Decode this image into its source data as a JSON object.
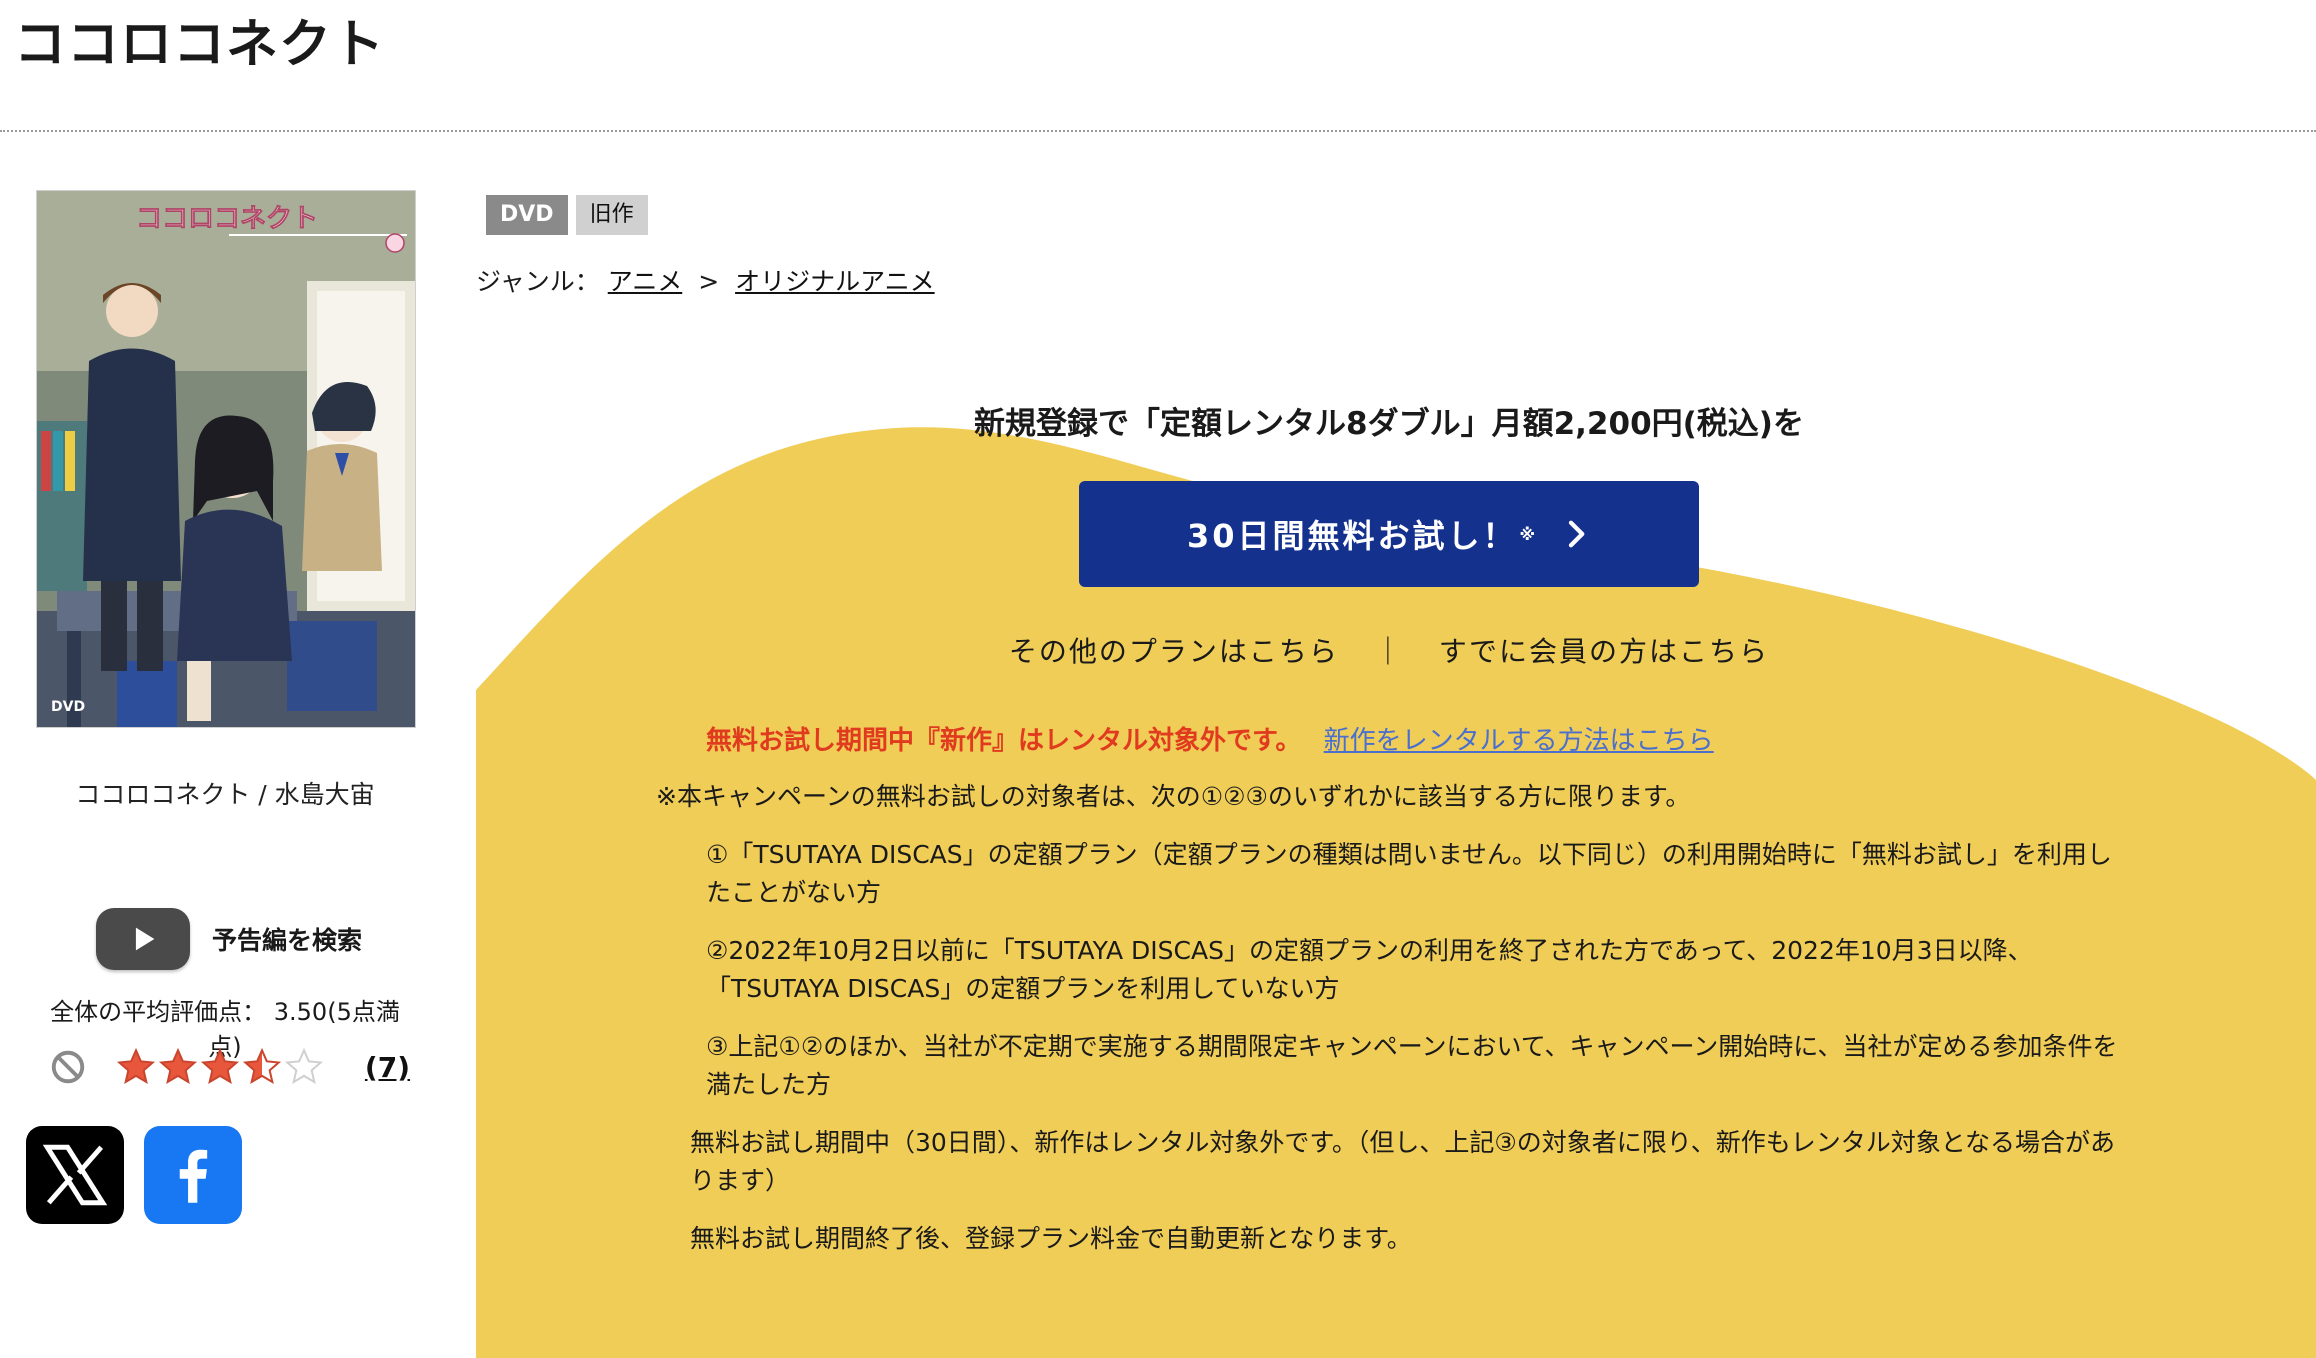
{
  "page": {
    "title": "ココロコネクト"
  },
  "product": {
    "cover_alt": "ココロコネクト",
    "cover_title_art": "ココロコネクト",
    "caption": "ココロコネクト / 水島大宙",
    "trailer_label": "予告編を検索",
    "rating_text": "全体の平均評価点： 3.50(5点満点)",
    "rating_value": 3.5,
    "rating_max": 5,
    "review_count": "(7)",
    "share": {
      "x_icon": "x-logo-icon",
      "facebook_icon": "facebook-icon"
    }
  },
  "badges": {
    "format": "DVD",
    "status": "旧作"
  },
  "genre": {
    "label": "ジャンル：",
    "items": [
      "アニメ",
      "オリジナルアニメ"
    ],
    "separator": ">"
  },
  "promo": {
    "headline": "新規登録で「定額レンタル8ダブル」月額2,200円(税込)を",
    "cta_label": "30日間無料お試し！",
    "cta_note": "※",
    "other_plans": "その他のプランはこちら",
    "divider": "｜",
    "members": "すでに会員の方はこちら",
    "warning": "無料お試し期間中『新作』はレンタル対象外です。",
    "warning_link": "新作をレンタルする方法はこちら",
    "colors": {
      "background": "#f0cd57",
      "cta": "#14318e",
      "warning": "#e03a1f",
      "link": "#4a6fcf"
    }
  },
  "terms": {
    "lead": "※本キャンペーンの無料お試しの対象者は、次の①②③のいずれかに該当する方に限ります。",
    "item1": "①「TSUTAYA DISCAS」の定額プラン（定額プランの種類は問いません。以下同じ）の利用開始時に「無料お試し」を利用したことがない方",
    "item2": "②2022年10月2日以前に「TSUTAYA DISCAS」の定額プランの利用を終了された方であって、2022年10月3日以降、「TSUTAYA DISCAS」の定額プランを利用していない方",
    "item3": "③上記①②のほか、当社が不定期で実施する期間限定キャンペーンにおいて、キャンペーン開始時に、当社が定める参加条件を満たした方",
    "note1": "無料お試し期間中（30日間）、新作はレンタル対象外です。（但し、上記③の対象者に限り、新作もレンタル対象となる場合があります）",
    "note2": "無料お試し期間終了後、登録プラン料金で自動更新となります。"
  }
}
